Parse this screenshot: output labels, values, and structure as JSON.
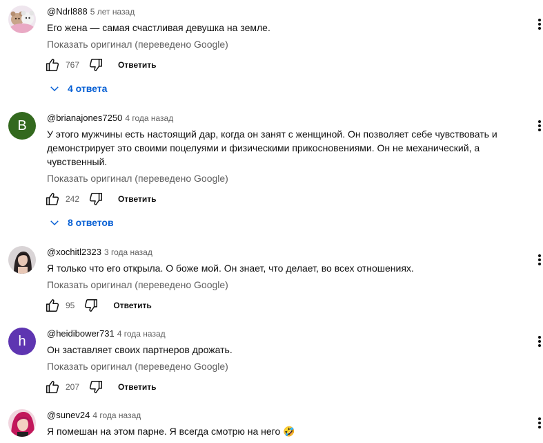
{
  "translate_label": "Показать оригинал (переведено Google)",
  "reply_label": "Ответить",
  "comments": [
    {
      "author": "@Ndrl888",
      "time": "5 лет назад",
      "text": "Его жена — самая счастливая девушка на земле.",
      "likes": "767",
      "replies": "4 ответа",
      "avatar": "plush-bears-photo"
    },
    {
      "author": "@brianajones7250",
      "time": "4 года назад",
      "text": "У этого мужчины есть настоящий дар, когда он занят с женщиной. Он позволяет себе чувствовать и демонстрирует это своими поцелуями и физическими прикосновениями. Он не механический, а чувственный.",
      "likes": "242",
      "replies": "8 ответов",
      "avatar_letter": "B",
      "avatar_color": "#33691e"
    },
    {
      "author": "@xochitl2323",
      "time": "3 года назад",
      "text": "Я только что его открыла. О боже мой. Он знает, что делает, во всех отношениях.",
      "likes": "95",
      "avatar": "woman-photo"
    },
    {
      "author": "@heidibower731",
      "time": "4 года назад",
      "text": "Он заставляет своих партнеров дрожать.",
      "likes": "207",
      "avatar_letter": "h",
      "avatar_color": "#5e35b1"
    },
    {
      "author": "@sunev24",
      "time": "4 года назад",
      "text": "Я помешан на этом парне. Я всегда смотрю на него 🤣",
      "avatar": "red-hair-photo"
    }
  ]
}
